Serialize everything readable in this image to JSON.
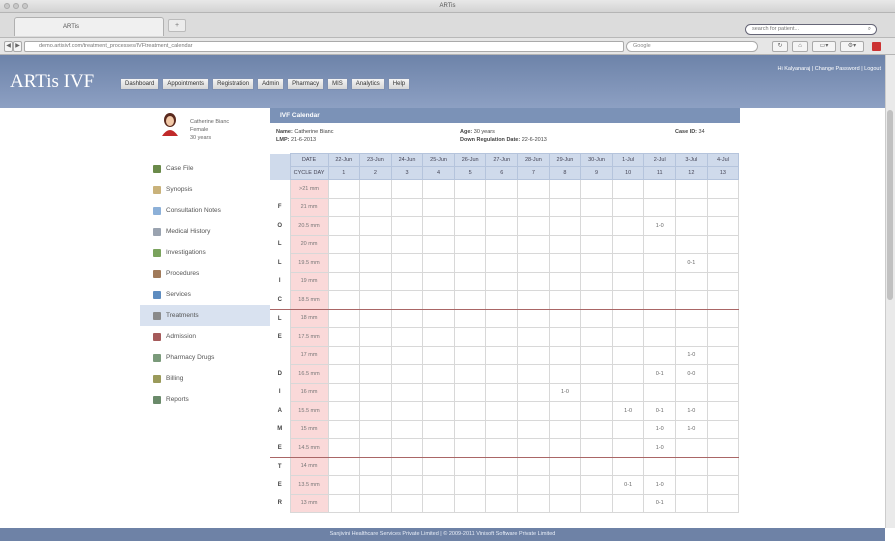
{
  "browser": {
    "window_title": "ARTis",
    "tab_title": "ARTis",
    "url": "demo.artisivf.com/treatment_processes/IVFtreatment_calendar",
    "search_placeholder": "Google",
    "back_label": "◀",
    "forward_label": "▶",
    "reader_label": "↻",
    "home_label": "⌂"
  },
  "app": {
    "logo": "ARTis IVF",
    "nav": [
      "Dashboard",
      "Appointments",
      "Registration",
      "Admin",
      "Pharmacy",
      "MIS",
      "Analytics",
      "Help"
    ],
    "user_links": "Hi Kalyanaraj | Change Password | Logout",
    "search_placeholder": "search for patient...",
    "search_icon": "magnifier-icon"
  },
  "patient": {
    "name": "Catherine Bianc",
    "gender": "Female",
    "age": "30 years"
  },
  "sidebar": {
    "items": [
      {
        "label": "Case File",
        "icon": "folder-icon",
        "color": "#6a8a4a"
      },
      {
        "label": "Synopsis",
        "icon": "document-icon",
        "color": "#c9b27a"
      },
      {
        "label": "Consultation Notes",
        "icon": "notes-icon",
        "color": "#8cb0d8"
      },
      {
        "label": "Medical History",
        "icon": "history-icon",
        "color": "#9aa3b0"
      },
      {
        "label": "Investigations",
        "icon": "flask-icon",
        "color": "#7aa35d"
      },
      {
        "label": "Procedures",
        "icon": "user-icon",
        "color": "#a07a5a"
      },
      {
        "label": "Services",
        "icon": "services-icon",
        "color": "#5d8cc0"
      },
      {
        "label": "Treatments",
        "icon": "treatment-icon",
        "color": "#8a8a8a",
        "active": true
      },
      {
        "label": "Admission",
        "icon": "bed-icon",
        "color": "#a55a5a"
      },
      {
        "label": "Pharmacy Drugs",
        "icon": "pill-icon",
        "color": "#7a9a7a"
      },
      {
        "label": "Billing",
        "icon": "billing-icon",
        "color": "#9a9a5a"
      },
      {
        "label": "Reports",
        "icon": "report-icon",
        "color": "#6a8a6a"
      }
    ]
  },
  "panel": {
    "title": "IVF Calendar",
    "name_label": "Name:",
    "name_value": "Catherine Bianc",
    "lmp_label": "LMP:",
    "lmp_value": "21-6-2013",
    "age_label": "Age:",
    "age_value": "30 years",
    "down_label": "Down Regulation Date:",
    "down_value": "22-6-2013",
    "case_label": "Case ID:",
    "case_value": "34"
  },
  "calendar": {
    "date_label": "DATE",
    "cycle_label": "CYCLE DAY",
    "dates": [
      "22-Jun",
      "23-Jun",
      "24-Jun",
      "25-Jun",
      "26-Jun",
      "27-Jun",
      "28-Jun",
      "29-Jun",
      "30-Jun",
      "1-Jul",
      "2-Jul",
      "3-Jul",
      "4-Jul"
    ],
    "cycle_days": [
      "1",
      "2",
      "3",
      "4",
      "5",
      "6",
      "7",
      "8",
      "9",
      "10",
      "11",
      "12",
      "13"
    ],
    "side_letters": [
      "",
      "",
      "",
      "",
      "",
      "",
      "",
      "",
      "",
      "F",
      "O",
      "L",
      "L",
      "I",
      "C",
      "L",
      "E",
      "",
      "D",
      "I",
      "A",
      "M",
      "E",
      "T",
      "E",
      "R"
    ],
    "rows": [
      {
        "size": ">21 mm",
        "cells": [
          "",
          "",
          "",
          "",
          "",
          "",
          "",
          "",
          "",
          "",
          "",
          "",
          ""
        ]
      },
      {
        "size": "21 mm",
        "cells": [
          "",
          "",
          "",
          "",
          "",
          "",
          "",
          "",
          "",
          "",
          "",
          "",
          ""
        ]
      },
      {
        "size": "20.5 mm",
        "cells": [
          "",
          "",
          "",
          "",
          "",
          "",
          "",
          "",
          "",
          "",
          "1-0",
          "",
          ""
        ]
      },
      {
        "size": "20 mm",
        "cells": [
          "",
          "",
          "",
          "",
          "",
          "",
          "",
          "",
          "",
          "",
          "",
          "",
          ""
        ]
      },
      {
        "size": "19.5 mm",
        "cells": [
          "",
          "",
          "",
          "",
          "",
          "",
          "",
          "",
          "",
          "",
          "",
          "0-1",
          ""
        ]
      },
      {
        "size": "19 mm",
        "cells": [
          "",
          "",
          "",
          "",
          "",
          "",
          "",
          "",
          "",
          "",
          "",
          "",
          ""
        ]
      },
      {
        "size": "18.5 mm",
        "cells": [
          "",
          "",
          "",
          "",
          "",
          "",
          "",
          "",
          "",
          "",
          "",
          "",
          ""
        ],
        "redline": true
      },
      {
        "size": "18 mm",
        "cells": [
          "",
          "",
          "",
          "",
          "",
          "",
          "",
          "",
          "",
          "",
          "",
          "",
          ""
        ]
      },
      {
        "size": "17.5 mm",
        "cells": [
          "",
          "",
          "",
          "",
          "",
          "",
          "",
          "",
          "",
          "",
          "",
          "",
          ""
        ]
      },
      {
        "size": "17 mm",
        "cells": [
          "",
          "",
          "",
          "",
          "",
          "",
          "",
          "",
          "",
          "",
          "",
          "1-0",
          ""
        ]
      },
      {
        "size": "16.5 mm",
        "cells": [
          "",
          "",
          "",
          "",
          "",
          "",
          "",
          "",
          "",
          "",
          "0-1",
          "0-0",
          ""
        ]
      },
      {
        "size": "16 mm",
        "cells": [
          "",
          "",
          "",
          "",
          "",
          "",
          "",
          "1-0",
          "",
          "",
          "",
          "",
          ""
        ]
      },
      {
        "size": "15.5 mm",
        "cells": [
          "",
          "",
          "",
          "",
          "",
          "",
          "",
          "",
          "",
          "1-0",
          "0-1",
          "1-0",
          ""
        ]
      },
      {
        "size": "15 mm",
        "cells": [
          "",
          "",
          "",
          "",
          "",
          "",
          "",
          "",
          "",
          "",
          "1-0",
          "1-0",
          ""
        ]
      },
      {
        "size": "14.5 mm",
        "cells": [
          "",
          "",
          "",
          "",
          "",
          "",
          "",
          "",
          "",
          "",
          "1-0",
          "",
          ""
        ],
        "redline": true
      },
      {
        "size": "14 mm",
        "cells": [
          "",
          "",
          "",
          "",
          "",
          "",
          "",
          "",
          "",
          "",
          "",
          "",
          ""
        ]
      },
      {
        "size": "13.5 mm",
        "cells": [
          "",
          "",
          "",
          "",
          "",
          "",
          "",
          "",
          "",
          "0-1",
          "1-0",
          "",
          ""
        ]
      },
      {
        "size": "13 mm",
        "cells": [
          "",
          "",
          "",
          "",
          "",
          "",
          "",
          "",
          "",
          "",
          "0-1",
          "",
          ""
        ]
      }
    ]
  },
  "footer": "Sanjivini Healthcare Services Private Limited | © 2009-2011 Vinisoft Software Private Limited"
}
